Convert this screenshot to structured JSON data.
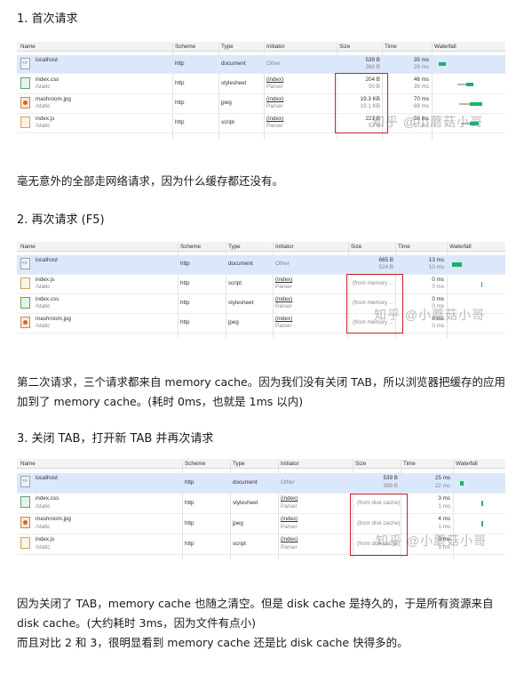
{
  "sections": [
    {
      "heading": "1. 首次请求",
      "paragraph": "毫无意外的全部走网络请求，因为什么缓存都还没有。",
      "table": {
        "columns": [
          "Name",
          "Scheme",
          "Type",
          "Initiator",
          "Size",
          "Time",
          "Waterfall"
        ],
        "rows": [
          {
            "name": "localhost",
            "path": "",
            "scheme": "http",
            "type": "document",
            "initiator": "Other",
            "initiator_sub": "",
            "size": "539 B",
            "size_sub": "398 B",
            "time": "35 ms",
            "time_sub": "28 ms",
            "icon": "html-file-icon"
          },
          {
            "name": "index.css",
            "path": "/static",
            "scheme": "http",
            "type": "stylesheet",
            "initiator": "(index)",
            "initiator_sub": "Parser",
            "size": "204 B",
            "size_sub": "50 B",
            "time": "46 ms",
            "time_sub": "39 ms",
            "icon": "css-file-icon"
          },
          {
            "name": "mashroom.jpg",
            "path": "/static",
            "scheme": "http",
            "type": "jpeg",
            "initiator": "(index)",
            "initiator_sub": "Parser",
            "size": "19.3 KB",
            "size_sub": "19.1 KB",
            "time": "70 ms",
            "time_sub": "68 ms",
            "icon": "image-file-icon"
          },
          {
            "name": "index.js",
            "path": "/static",
            "scheme": "http",
            "type": "script",
            "initiator": "(index)",
            "initiator_sub": "Parser",
            "size": "221 B",
            "size_sub": "57 B",
            "time": "58 ms",
            "time_sub": "57 ms",
            "icon": "js-file-icon"
          }
        ]
      }
    },
    {
      "heading": "2. 再次请求 (F5)",
      "paragraph": "第二次请求，三个请求都来自 memory cache。因为我们没有关闭 TAB，所以浏览器把缓存的应用加到了 memory cache。(耗时 0ms，也就是 1ms 以内)",
      "table": {
        "columns": [
          "Name",
          "Scheme",
          "Type",
          "Initiator",
          "Size",
          "Time",
          "Waterfall"
        ],
        "rows": [
          {
            "name": "localhost",
            "path": "",
            "scheme": "http",
            "type": "document",
            "initiator": "Other",
            "initiator_sub": "",
            "size": "665 B",
            "size_sub": "524 B",
            "time": "13 ms",
            "time_sub": "10 ms",
            "icon": "html-file-icon"
          },
          {
            "name": "index.js",
            "path": "/static",
            "scheme": "http",
            "type": "script",
            "initiator": "(index)",
            "initiator_sub": "Parser",
            "size": "(from memory ...",
            "size_sub": "",
            "time": "0 ms",
            "time_sub": "0 ms",
            "icon": "js-file-icon"
          },
          {
            "name": "index.css",
            "path": "/static",
            "scheme": "http",
            "type": "stylesheet",
            "initiator": "(index)",
            "initiator_sub": "Parser",
            "size": "(from memory ...",
            "size_sub": "",
            "time": "0 ms",
            "time_sub": "0 ms",
            "icon": "css-file-icon"
          },
          {
            "name": "mashroom.jpg",
            "path": "/static",
            "scheme": "http",
            "type": "jpeg",
            "initiator": "(index)",
            "initiator_sub": "Parser",
            "size": "(from memory ...",
            "size_sub": "",
            "time": "0 ms",
            "time_sub": "0 ms",
            "icon": "image-file-icon"
          }
        ]
      }
    },
    {
      "heading": "3. 关闭 TAB，打开新 TAB 并再次请求",
      "paragraph": "因为关闭了 TAB，memory cache 也随之清空。但是 disk cache 是持久的，于是所有资源来自 disk cache。(大约耗时 3ms，因为文件有点小)",
      "paragraph2": "而且对比 2 和 3，很明显看到 memory cache 还是比 disk cache 快得多的。",
      "table": {
        "columns": [
          "Name",
          "Scheme",
          "Type",
          "Initiator",
          "Size",
          "Time",
          "Waterfall"
        ],
        "rows": [
          {
            "name": "localhost",
            "path": "",
            "scheme": "http",
            "type": "document",
            "initiator": "Other",
            "initiator_sub": "",
            "size": "539 B",
            "size_sub": "398 B",
            "time": "25 ms",
            "time_sub": "22 ms",
            "icon": "html-file-icon"
          },
          {
            "name": "index.css",
            "path": "/static",
            "scheme": "http",
            "type": "stylesheet",
            "initiator": "(index)",
            "initiator_sub": "Parser",
            "size": "(from disk cache)",
            "size_sub": "",
            "time": "3 ms",
            "time_sub": "1 ms",
            "icon": "css-file-icon"
          },
          {
            "name": "mashroom.jpg",
            "path": "/static",
            "scheme": "http",
            "type": "jpeg",
            "initiator": "(index)",
            "initiator_sub": "Parser",
            "size": "(from disk cache)",
            "size_sub": "",
            "time": "4 ms",
            "time_sub": "1 ms",
            "icon": "image-file-icon"
          },
          {
            "name": "index.js",
            "path": "/static",
            "scheme": "http",
            "type": "script",
            "initiator": "(index)",
            "initiator_sub": "Parser",
            "size": "(from disk cache)",
            "size_sub": "",
            "time": "3 ms",
            "time_sub": "1 ms",
            "icon": "js-file-icon"
          }
        ]
      }
    }
  ],
  "watermark": "知乎 @小蘑菇小哥",
  "colors": {
    "highlight": "#c8202a",
    "selected_row": "#dbe8fb",
    "waterfall_bar": "#17b46a"
  }
}
